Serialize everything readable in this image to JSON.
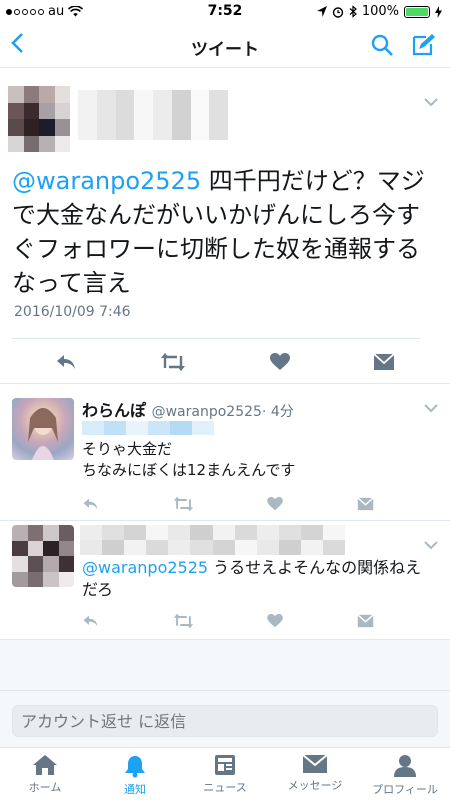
{
  "status_bar": {
    "carrier": "au",
    "time": "7:52",
    "battery": "100%",
    "battery_level": 1.0
  },
  "nav": {
    "title": "ツイート"
  },
  "main_tweet": {
    "mention": "@waranpo2525",
    "text": " 四千円だけど？マジで大金なんだがいいかげんにしろ今すぐフォロワーに切断した奴を通報するなって言え",
    "date": "2016/10/09 7:46"
  },
  "replies": [
    {
      "name": "わらんぽ",
      "handle": "@waranpo2525",
      "time": "· 4分",
      "text_line1": "そりゃ大金だ",
      "text_line2": "ちなみにぼくは12まんえんです"
    },
    {
      "mention": "@waranpo2525",
      "text": " うるせえよそんなの関係ねえだろ"
    }
  ],
  "reply_input": {
    "placeholder": "アカウント返せ に返信"
  },
  "tabs": [
    {
      "label": "ホーム",
      "icon": "home-icon"
    },
    {
      "label": "通知",
      "icon": "bell-icon"
    },
    {
      "label": "ニュース",
      "icon": "news-icon"
    },
    {
      "label": "メッセージ",
      "icon": "envelope-icon"
    },
    {
      "label": "プロフィール",
      "icon": "person-icon"
    }
  ],
  "colors": {
    "accent": "#1da1f2",
    "muted": "#657786",
    "icon_gray": "#aab8c2"
  }
}
